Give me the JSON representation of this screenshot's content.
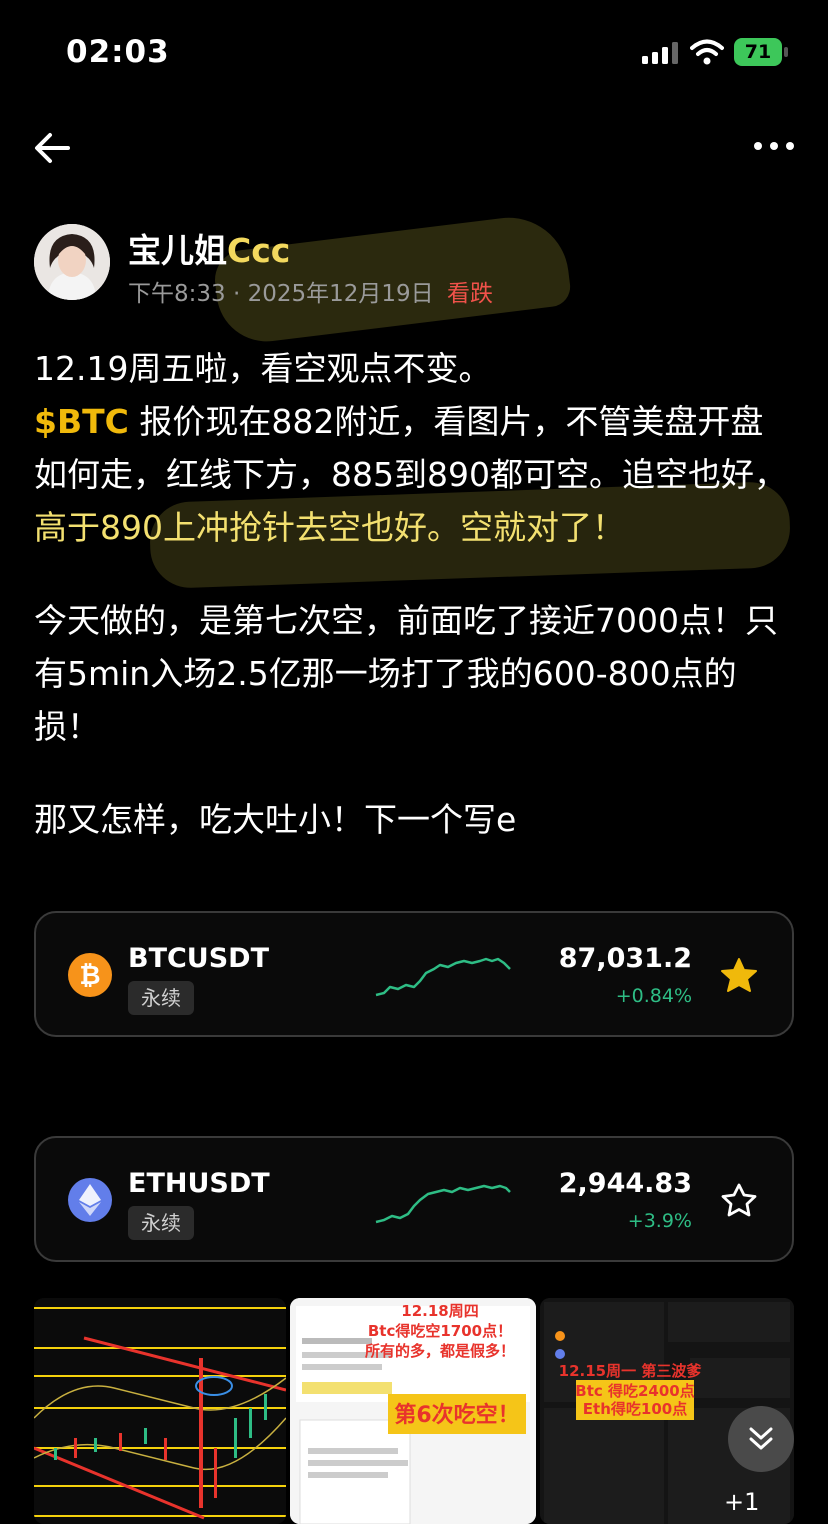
{
  "status_bar": {
    "time": "02:03",
    "battery": "71"
  },
  "nav": {
    "back_icon": "arrow-left-icon",
    "more_icon": "more-dots-icon"
  },
  "author": {
    "name_main": "宝儿姐",
    "name_suffix": "Ccc",
    "time": "下午8:33",
    "date": "2025年12月19日",
    "sentiment": "看跌"
  },
  "post": {
    "line1": "12.19周五啦，看空观点不变。",
    "ticker": "$BTC",
    "p1_a": " 报价现在882附近，看图片，不管美盘开盘如何走，红线下方，885到890都可空。追空也好，",
    "p1_b": "高于890上冲抢针去空也好。空就对了！",
    "p2": "今天做的，是第七次空，前面吃了接近7000点！只有5min入场2.5亿那一场打了我的600-800点的损！",
    "p3": "那又怎样，吃大吐小！下一个写e"
  },
  "cards": [
    {
      "symbol": "BTCUSDT",
      "tag": "永续",
      "price": "87,031.2",
      "change": "+0.84%",
      "starred": true,
      "icon": "bitcoin-icon",
      "icon_color": "#f7931a"
    },
    {
      "symbol": "ETHUSDT",
      "tag": "永续",
      "price": "2,944.83",
      "change": "+3.9%",
      "starred": false,
      "icon": "ethereum-icon",
      "icon_color": "#627eea"
    }
  ],
  "gallery": {
    "more_count": "+1",
    "thumb2_caption_top": "12.18周四",
    "thumb2_caption_mid": "Btc得吃空1700点！",
    "thumb2_caption_low": "所有的多，都是假多！",
    "thumb2_badge": "第6次吃空！",
    "thumb3_line1": "12.15周一 第三波爹",
    "thumb3_line2": "Btc 得吃2400点",
    "thumb3_line3": "Eth得吃100点"
  },
  "colors": {
    "accent_yellow": "#f0b90b",
    "positive_green": "#2ebd85",
    "bear_red": "#f0524a"
  }
}
